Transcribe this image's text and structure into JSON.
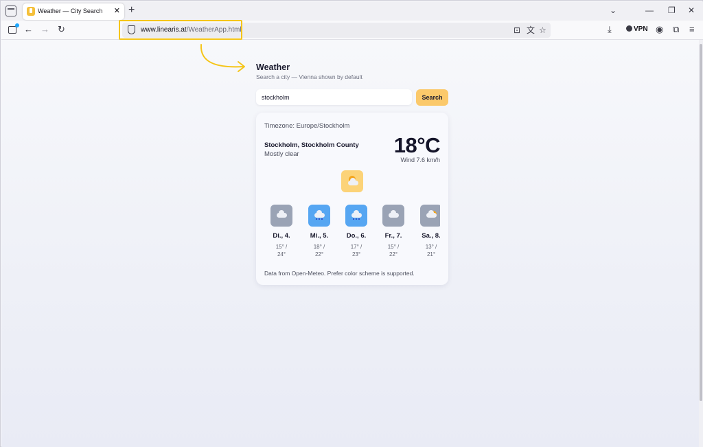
{
  "browser": {
    "tab": {
      "title": "Weather — City Search",
      "close_glyph": "✕"
    },
    "new_tab_glyph": "+",
    "window_controls": [
      "⌄",
      "—",
      "❐",
      "✕"
    ],
    "nav": {
      "back": "←",
      "forward": "→",
      "reload": "↻"
    },
    "url": {
      "domain": "www.linearis.at",
      "path": "/WeatherApp.html"
    },
    "vpn_label": "VPN",
    "url_icons": [
      "reader-view-icon",
      "translate-icon",
      "bookmark-star-icon"
    ],
    "toolbar_icons": [
      "download-icon",
      "vpn-icon",
      "account-icon",
      "extensions-icon",
      "menu-icon"
    ]
  },
  "app": {
    "title": "Weather",
    "subtitle": "Search a city — Vienna shown by default",
    "search": {
      "value": "stockholm",
      "button_label": "Search"
    }
  },
  "weather": {
    "timezone": "Timezone: Europe/Stockholm",
    "city": "Stockholm, Stockholm County",
    "condition": "Mostly clear",
    "temperature": "18°C",
    "wind": "Wind 7.6 km/h",
    "main_icon": "partly-sunny-icon",
    "forecast": [
      {
        "day": "Di., 4.",
        "range_low": "15° /",
        "range_high": "24°",
        "icon": "cloud-icon",
        "color": "#9aa3b5"
      },
      {
        "day": "Mi., 5.",
        "range_low": "18° /",
        "range_high": "22°",
        "icon": "rain-icon",
        "color": "#56a6f2"
      },
      {
        "day": "Do., 6.",
        "range_low": "17° /",
        "range_high": "23°",
        "icon": "rain-icon",
        "color": "#56a6f2"
      },
      {
        "day": "Fr., 7.",
        "range_low": "15° /",
        "range_high": "22°",
        "icon": "cloud-icon",
        "color": "#9aa3b5"
      },
      {
        "day": "Sa., 8.",
        "range_low": "13° /",
        "range_high": "21°",
        "icon": "partly-cloudy-icon",
        "color": "#9aa3b5"
      }
    ],
    "footer": "Data from Open-Meteo. Prefer color scheme is supported."
  },
  "colors": {
    "accent": "#fbc96b",
    "highlight": "#f5c518",
    "rain": "#56a6f2",
    "cloud": "#9aa3b5"
  }
}
